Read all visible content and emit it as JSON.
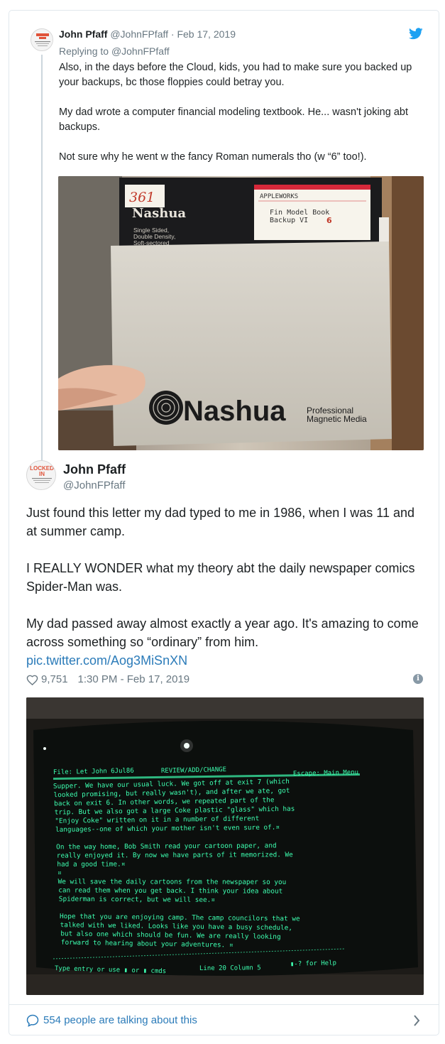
{
  "parent_tweet": {
    "author_name": "John Pfaff",
    "author_handle": "@JohnFPfaff",
    "separator": "·",
    "date": "Feb 17, 2019",
    "replying_label": "Replying to",
    "replying_to": "@JohnFPfaff",
    "paragraphs": [
      "Also, in the days before the Cloud, kids, you had to make sure you backed up your backups, bc those floppies could betray you.",
      "My dad wrote a computer financial modeling textbook. He... wasn't joking abt backups.",
      "Not sure why he went w the fancy Roman numerals tho (w “6” too!)."
    ],
    "photo": {
      "disk_number": "361",
      "disk_brand": "Nashua",
      "disk_specs": [
        "Single Sided,",
        "Double Density,",
        "Soft-sectored"
      ],
      "label_maker": "APPLEWORKS",
      "label_line1": "Fin Model Book",
      "label_line2": "Backup VI",
      "label_digit": "6",
      "sleeve_brand": "Nashua",
      "sleeve_tagline_1": "Professional",
      "sleeve_tagline_2": "Magnetic Media"
    }
  },
  "main_tweet": {
    "author_name": "John Pfaff",
    "author_handle": "@JohnFPfaff",
    "avatar_text_1": "LOCKED",
    "avatar_text_2": "IN",
    "paragraphs": [
      "Just found this letter my dad typed to me in 1986, when I was 11 and at summer camp.",
      "I REALLY WONDER what my theory abt the daily newspaper comics Spider-Man was.",
      "My dad passed away almost exactly a year ago. It's amazing to come across something so “ordinary” from him."
    ],
    "link": "pic.twitter.com/Aog3MiSnXN",
    "likes": "9,751",
    "timestamp": "1:30 PM - Feb 17, 2019",
    "screen": {
      "header_left": "File: Let John 6Jul86",
      "header_mid": "REVIEW/ADD/CHANGE",
      "header_right": "Escape: Main Menu",
      "lines": [
        "Supper. We have our usual luck. We got off at exit 7 (which",
        "looked promising, but really wasn't), and after we ate, got",
        "back on exit 6. In other words, we repeated part of the",
        "trip. But we also got a large Coke plastic \"glass\" which has",
        "\"Enjoy Coke\" written on it in a number of different",
        "languages--one of which your mother isn't even sure of.¤",
        "",
        "On the way home, Bob Smith read your cartoon paper, and",
        "really enjoyed it. By now we have parts of it memorized. We",
        "had a good time.¤",
        "¤",
        "We will save the daily cartoons from the newspaper so you",
        "can read them when you get back. I think your idea about",
        "Spiderman is correct, but we will see.¤",
        "",
        "Hope that you are enjoying camp. The camp councilors that we",
        "talked with we liked. Looks like you have a busy schedule,",
        "but also one which should be fun. We are really looking",
        "forward to hearing about your adventures. ¤"
      ],
      "footer_left": "Type entry or use ▮ or ▮ cmds",
      "footer_mid": "Line 20  Column  5",
      "footer_right": "▮-? for Help"
    }
  },
  "footer": {
    "talking": "554 people are talking about this"
  },
  "colors": {
    "link": "#2b7bb9",
    "twitter_blue": "#1da1f2",
    "muted": "#697882",
    "text": "#1c2022",
    "border": "#e1e8ed",
    "crt_green": "#3dffb0"
  }
}
